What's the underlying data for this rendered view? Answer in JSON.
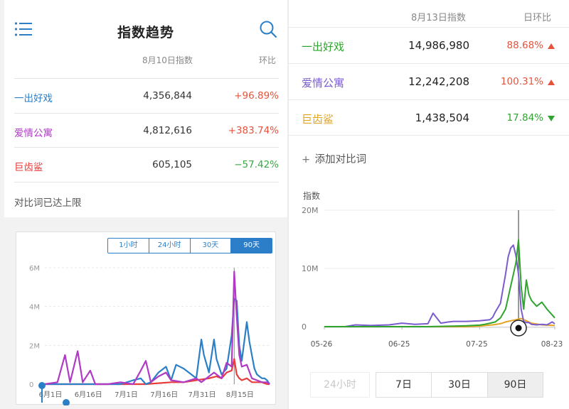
{
  "left": {
    "title": "指数趋势",
    "col_index": "8月10日指数",
    "col_change": "环比",
    "rows": [
      {
        "name": "一出好戏",
        "value": "4,356,844",
        "change": "+96.89%",
        "name_color": "#2b7fc6",
        "change_color": "#e5533c"
      },
      {
        "name": "爱情公寓",
        "value": "4,812,616",
        "change": "+383.74%",
        "name_color": "#b03ac6",
        "change_color": "#e5533c"
      },
      {
        "name": "巨齿鲨",
        "value": "605,105",
        "change": "−57.42%",
        "name_color": "#e83b3b",
        "change_color": "#3aa840"
      }
    ],
    "limit_text": "对比词已达上限",
    "range_tabs": [
      "1小时",
      "24小时",
      "30天",
      "90天"
    ],
    "active_range": "90天",
    "chart_data": {
      "type": "line",
      "x_ticks": [
        "6月1日",
        "6月16日",
        "7月1日",
        "7月16日",
        "7月31日",
        "8月15日"
      ],
      "y_ticks": [
        "0",
        "2M",
        "4M",
        "6M"
      ],
      "ylim": [
        0,
        6000000
      ],
      "series": [
        {
          "name": "一出好戏",
          "color": "#2b7fc6",
          "x": [
            0,
            5,
            10,
            15,
            20,
            25,
            30,
            35,
            38,
            40,
            42,
            45,
            48,
            50,
            52,
            55,
            58,
            60,
            62,
            63,
            65,
            67,
            68,
            70,
            72,
            74,
            75,
            76,
            77,
            78,
            80,
            81,
            82,
            83,
            84,
            85,
            86,
            87,
            88,
            89
          ],
          "values": [
            0,
            0,
            0,
            0,
            0,
            0,
            0,
            200000,
            300000,
            0,
            100000,
            600000,
            900000,
            200000,
            1000000,
            800000,
            500000,
            300000,
            2300000,
            1500000,
            600000,
            2300000,
            1300000,
            500000,
            800000,
            2500000,
            4400000,
            4300000,
            2000000,
            1200000,
            3200000,
            2200000,
            1500000,
            800000,
            500000,
            400000,
            300000,
            300000,
            200000,
            0
          ]
        },
        {
          "name": "爱情公寓",
          "color": "#b03ac6",
          "x": [
            0,
            5,
            8,
            10,
            13,
            15,
            18,
            20,
            25,
            30,
            35,
            38,
            40,
            42,
            45,
            48,
            50,
            55,
            60,
            62,
            65,
            67,
            70,
            72,
            74,
            75,
            76,
            77,
            78,
            80,
            82,
            84,
            86,
            88,
            89
          ],
          "values": [
            0,
            100000,
            1500000,
            100000,
            1700000,
            100000,
            700000,
            0,
            0,
            100000,
            0,
            700000,
            1200000,
            100000,
            400000,
            600000,
            200000,
            100000,
            300000,
            100000,
            400000,
            600000,
            300000,
            1100000,
            900000,
            5800000,
            3500000,
            1500000,
            900000,
            1000000,
            300000,
            200000,
            100000,
            100000,
            0
          ]
        },
        {
          "name": "巨齿鲨",
          "color": "#e83b3b",
          "x": [
            0,
            10,
            20,
            30,
            40,
            50,
            55,
            60,
            65,
            68,
            70,
            72,
            74,
            75,
            76,
            77,
            78,
            80,
            82,
            84,
            86,
            88,
            89
          ],
          "values": [
            0,
            0,
            0,
            0,
            0,
            100000,
            100000,
            200000,
            300000,
            400000,
            300000,
            600000,
            700000,
            1300000,
            500000,
            300000,
            200000,
            300000,
            100000,
            100000,
            100000,
            0,
            0
          ]
        }
      ]
    }
  },
  "right": {
    "col_index": "8月13日指数",
    "col_change": "日环比",
    "rows": [
      {
        "name": "一出好戏",
        "value": "14,986,980",
        "change": "88.68%",
        "direction": "up",
        "name_color": "#2fa52f",
        "change_color": "#e5533c"
      },
      {
        "name": "爱情公寓",
        "value": "12,242,208",
        "change": "100.31%",
        "direction": "up",
        "name_color": "#7b5ccf",
        "change_color": "#e5533c"
      },
      {
        "name": "巨齿鲨",
        "value": "1,438,504",
        "change": "17.84%",
        "direction": "down",
        "name_color": "#e3a521",
        "change_color": "#2fa52f"
      }
    ],
    "add_compare_icon": "+",
    "add_compare": "添加对比词",
    "range_buttons": [
      "24小时",
      "7日",
      "30日",
      "90日"
    ],
    "disabled_button": "24小时",
    "active_button": "90日",
    "chart_data": {
      "type": "line",
      "y_label": "指数",
      "y_ticks": [
        "20M",
        "10M",
        "0"
      ],
      "x_ticks": [
        "05-26",
        "06-25",
        "07-25",
        "08-23"
      ],
      "ylim": [
        0,
        20000000
      ],
      "series": [
        {
          "name": "一出好戏",
          "color": "#2fa52f",
          "x": [
            0,
            10,
            20,
            30,
            40,
            50,
            55,
            60,
            62,
            64,
            66,
            68,
            70,
            71,
            72,
            73,
            74,
            75,
            76,
            77,
            78,
            79,
            80,
            82,
            84,
            86,
            88,
            89
          ],
          "values": [
            0,
            0,
            0,
            0,
            0,
            100000,
            150000,
            250000,
            400000,
            600000,
            800000,
            1500000,
            3000000,
            5000000,
            7000000,
            9000000,
            11000000,
            14900000,
            7000000,
            3000000,
            8000000,
            5500000,
            4500000,
            3500000,
            4200000,
            3000000,
            2000000,
            1500000
          ]
        },
        {
          "name": "爱情公寓",
          "color": "#7b5ccf",
          "x": [
            0,
            8,
            12,
            18,
            25,
            30,
            35,
            40,
            42,
            45,
            48,
            50,
            55,
            60,
            64,
            65,
            66,
            68,
            70,
            71,
            72,
            73,
            74,
            75,
            76,
            77,
            78,
            79,
            80,
            82,
            84,
            86,
            88,
            89
          ],
          "values": [
            0,
            0,
            300000,
            200000,
            300000,
            600000,
            400000,
            500000,
            2300000,
            600000,
            800000,
            900000,
            900000,
            1000000,
            1200000,
            1600000,
            2500000,
            4000000,
            9000000,
            12000000,
            13500000,
            14000000,
            12200000,
            9000000,
            3000000,
            900000,
            700000,
            700000,
            400000,
            300000,
            400000,
            300000,
            800000,
            500000
          ]
        },
        {
          "name": "巨齿鲨",
          "color": "#e3a521",
          "x": [
            0,
            10,
            20,
            30,
            40,
            50,
            55,
            60,
            62,
            65,
            68,
            70,
            72,
            74,
            76,
            78,
            80,
            84,
            89
          ],
          "values": [
            0,
            0,
            0,
            0,
            0,
            0,
            0,
            100000,
            200000,
            300000,
            500000,
            800000,
            1000000,
            1200000,
            1400000,
            1000000,
            600000,
            300000,
            200000
          ]
        }
      ]
    }
  },
  "icons": {
    "menu": "list-menu-icon",
    "search": "search-icon",
    "up": "triangle-up-icon",
    "down": "triangle-down-icon",
    "add": "plus-icon"
  }
}
